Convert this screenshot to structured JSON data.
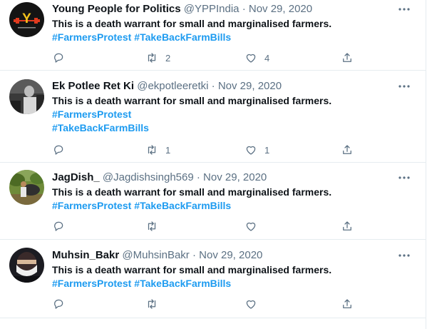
{
  "tweets": [
    {
      "name": "Young People for Politics",
      "handle": "@YPPIndia",
      "sep": "·",
      "date": "Nov 29, 2020",
      "text": "This is a death warrant for small and marginalised farmers.",
      "hashtags": [
        "#FarmersProtest",
        "#TakeBackFarmBills"
      ],
      "hashtag_layout": "inline",
      "retweets": "2",
      "likes": "4",
      "avatar_logo_text": "Y",
      "avatar": "ypp-logo"
    },
    {
      "name": "Ek Potlee Ret Ki",
      "handle": "@ekpotleeretki",
      "sep": "·",
      "date": "Nov 29, 2020",
      "text": "This is a death warrant for small and marginalised farmers.",
      "hashtags": [
        "#FarmersProtest",
        "#TakeBackFarmBills"
      ],
      "hashtag_layout": "stacked",
      "retweets": "1",
      "likes": "1",
      "avatar": "bw-photo"
    },
    {
      "name": "JagDish_",
      "handle": "@Jagdishsingh569",
      "sep": "·",
      "date": "Nov 29, 2020",
      "text": "This is a death warrant for small and marginalised farmers.",
      "hashtags": [
        "#FarmersProtest",
        "#TakeBackFarmBills"
      ],
      "hashtag_layout": "inline",
      "retweets": "",
      "likes": "",
      "avatar": "field-photo"
    },
    {
      "name": "Muhsin_Bakr",
      "handle": "@MuhsinBakr",
      "sep": "·",
      "date": "Nov 29, 2020",
      "text": "This is a death warrant for small and marginalised farmers.",
      "hashtags": [
        "#FarmersProtest",
        "#TakeBackFarmBills"
      ],
      "hashtag_layout": "inline",
      "retweets": "",
      "likes": "",
      "avatar": "masked-face-photo"
    }
  ],
  "icons": {
    "reply": "reply-icon",
    "retweet": "retweet-icon",
    "like": "heart-icon",
    "share": "share-icon",
    "more": "more-icon"
  },
  "colors": {
    "hashtag": "#1d9bf0",
    "meta": "#5b7083",
    "text": "#0f1419",
    "divider": "#e6ecf0"
  }
}
